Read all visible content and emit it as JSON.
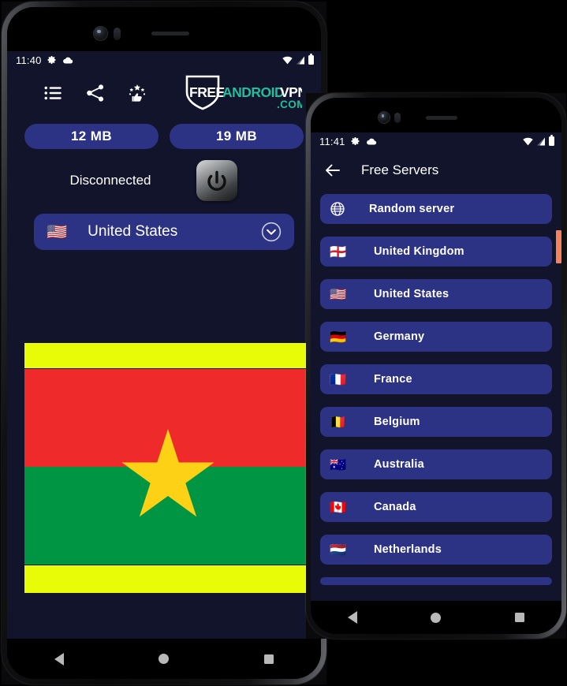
{
  "app": {
    "background_color": "#11142b",
    "accent_color": "#2d3384",
    "ad_color": "#e8fb07",
    "scrollbar_color": "#f4825e"
  },
  "phone1": {
    "status_bar": {
      "time": "11:40",
      "left_icons": [
        "gear-icon",
        "cloud-icon"
      ],
      "right_icons": [
        "wifi-icon",
        "signal-icon",
        "battery-icon"
      ]
    },
    "toolbar": {
      "icons": [
        {
          "name": "menu-list-icon",
          "label": "Menu"
        },
        {
          "name": "share-icon",
          "label": "Share"
        },
        {
          "name": "rate-us-icon",
          "label": "Rate us"
        }
      ],
      "logo": {
        "part1": "FREE",
        "part2": "ANDROID",
        "part3": "VPN",
        "part4": ".COM",
        "color1": "#ffffff",
        "color2": "#1fbf9c",
        "color3": "#ffffff",
        "color4": "#1fbf9c"
      }
    },
    "stats": {
      "download": "12 MB",
      "upload": "19 MB"
    },
    "connection": {
      "status": "Disconnected",
      "power_button": "power-icon"
    },
    "country_selector": {
      "flag": "🇺🇸",
      "name": "United States",
      "chevron": "chevron-down-icon"
    },
    "flag_hero": {
      "country": "Burkina Faso",
      "band_top_color": "#ee2a2a",
      "band_bottom_color": "#009543",
      "star_color": "#fcd116"
    },
    "nav_bar": [
      "back-button",
      "home-button",
      "recents-button"
    ]
  },
  "phone2": {
    "status_bar": {
      "time": "11:41",
      "left_icons": [
        "gear-icon",
        "cloud-icon"
      ],
      "right_icons": [
        "wifi-icon",
        "signal-icon",
        "battery-icon"
      ]
    },
    "appbar": {
      "back": "back-arrow-icon",
      "title": "Free Servers"
    },
    "servers": [
      {
        "icon": "globe-icon",
        "flag": "",
        "name": "Random server"
      },
      {
        "icon": "flag",
        "flag": "🏴󠁧󠁢󠁥󠁮󠁧󠁿",
        "name": "United Kingdom"
      },
      {
        "icon": "flag",
        "flag": "🇺🇸",
        "name": "United States"
      },
      {
        "icon": "flag",
        "flag": "🇩🇪",
        "name": "Germany"
      },
      {
        "icon": "flag",
        "flag": "🇫🇷",
        "name": "France"
      },
      {
        "icon": "flag",
        "flag": "🇧🇪",
        "name": "Belgium"
      },
      {
        "icon": "flag",
        "flag": "🇦🇺",
        "name": "Australia"
      },
      {
        "icon": "flag",
        "flag": "🇨🇦",
        "name": "Canada"
      },
      {
        "icon": "flag",
        "flag": "🇳🇱",
        "name": "Netherlands"
      }
    ],
    "nav_bar": [
      "back-button",
      "home-button",
      "recents-button"
    ]
  }
}
